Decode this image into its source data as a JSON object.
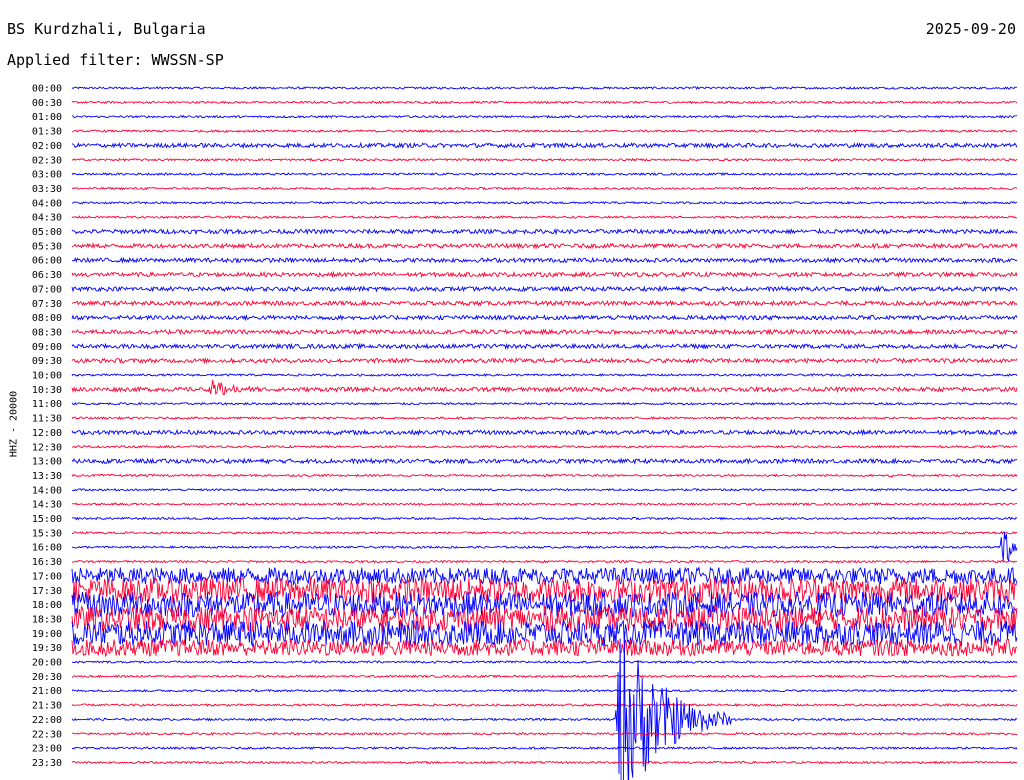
{
  "header": {
    "station": "BS Kurdzhali, Bulgaria",
    "date": "2025-09-20",
    "filter": "Applied filter: WWSSN-SP"
  },
  "chart_data": {
    "type": "line",
    "title": "BS Kurdzhali, Bulgaria",
    "ylabel": "HHZ - 20000",
    "xlabel": "",
    "rows": [
      "00:00",
      "00:30",
      "01:00",
      "01:30",
      "02:00",
      "02:30",
      "03:00",
      "03:30",
      "04:00",
      "04:30",
      "05:00",
      "05:30",
      "06:00",
      "06:30",
      "07:00",
      "07:30",
      "08:00",
      "08:30",
      "09:00",
      "09:30",
      "10:00",
      "10:30",
      "11:00",
      "11:30",
      "12:00",
      "12:30",
      "13:00",
      "13:30",
      "14:00",
      "14:30",
      "15:00",
      "15:30",
      "16:00",
      "16:30",
      "17:00",
      "17:30",
      "18:00",
      "18:30",
      "19:00",
      "19:30",
      "20:00",
      "20:30",
      "21:00",
      "21:30",
      "22:00",
      "22:30",
      "23:00",
      "23:30"
    ],
    "colors": {
      "even": "#0000ff",
      "odd": "#ff0033"
    },
    "grid": false,
    "x_range": [
      0,
      30
    ],
    "x_unit": "minutes",
    "noise_level": [
      1,
      1,
      1,
      1,
      2,
      1,
      1,
      1,
      1,
      1,
      2,
      2,
      2,
      2,
      2,
      2,
      2,
      2,
      2,
      2,
      1,
      2,
      1,
      1,
      2,
      1,
      2,
      1,
      1,
      1,
      1,
      1,
      1,
      1,
      8,
      12,
      12,
      12,
      12,
      8,
      1,
      1,
      1,
      1,
      1,
      1,
      1,
      1
    ],
    "high_noise_rows": [
      "16:30",
      "17:00",
      "17:30",
      "18:00",
      "18:30"
    ],
    "events": [
      {
        "row": "10:30",
        "minute": 4.5,
        "duration_min": 1.5,
        "amplitude": 10
      },
      {
        "row": "13:30",
        "minute": 26,
        "duration_min": 0.3,
        "amplitude": 3
      },
      {
        "row": "16:00",
        "minute": 29.6,
        "duration_min": 0.6,
        "amplitude": 28
      },
      {
        "row": "22:00",
        "minute": 17.4,
        "duration_min": 3.5,
        "amplitude": 100
      }
    ]
  }
}
